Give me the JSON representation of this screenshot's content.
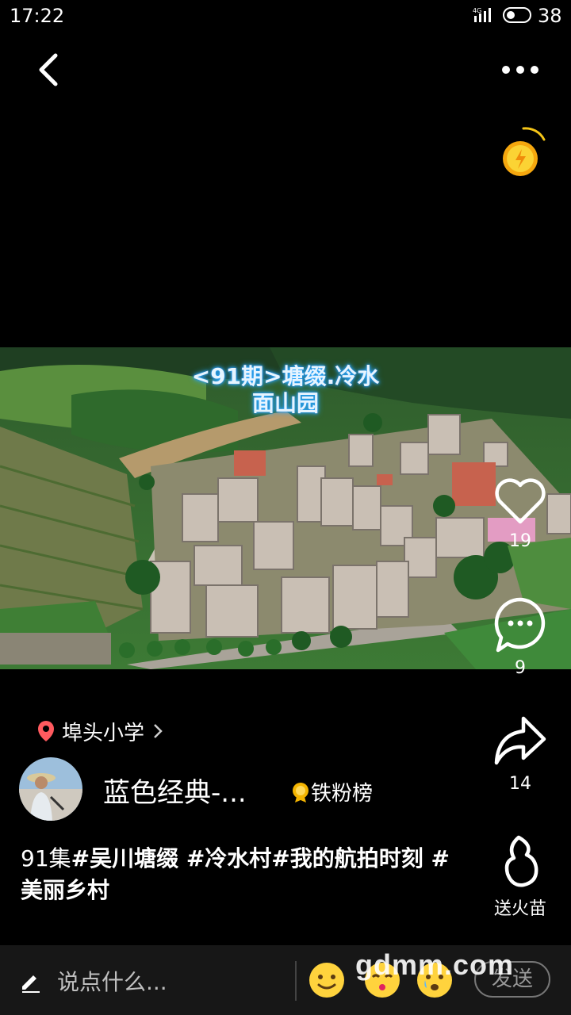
{
  "status": {
    "time": "17:22",
    "network": "4G",
    "battery": "38"
  },
  "video": {
    "title_line1": "<91期>塘缀.冷水",
    "title_line2": "面山园"
  },
  "actions": {
    "likes": "19",
    "comments": "9",
    "shares": "14",
    "fire_label": "送火苗"
  },
  "location": {
    "name": "埠头小学"
  },
  "author": {
    "name": "蓝色经典-...",
    "fans_label": "铁粉榜"
  },
  "description": {
    "lead": " 91集",
    "tags": "#吴川塘缀 #冷水村#我的航拍时刻 #美丽乡村"
  },
  "bottom": {
    "comment_placeholder": "说点什么...",
    "send_label": "发送",
    "watermark": "gdmm.com"
  }
}
